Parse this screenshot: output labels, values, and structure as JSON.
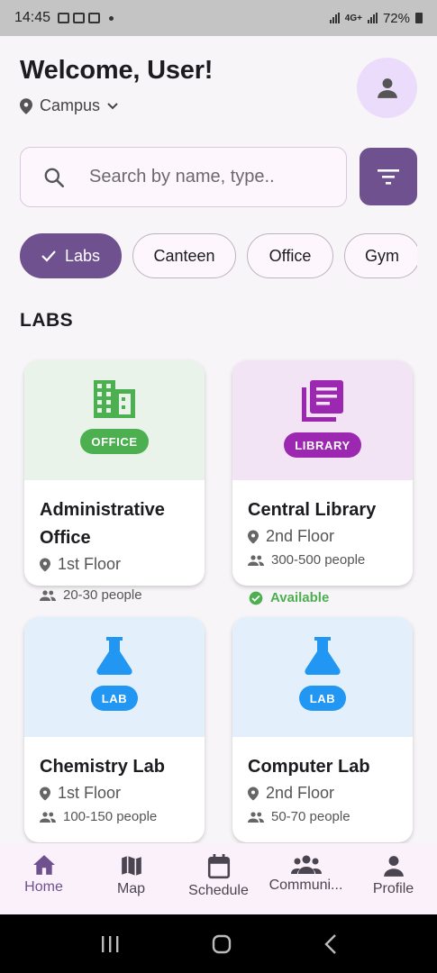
{
  "status_bar": {
    "time": "14:45",
    "network": "4G+",
    "battery": "72%"
  },
  "header": {
    "welcome": "Welcome, User!",
    "location": "Campus"
  },
  "search": {
    "placeholder": "Search by name, type.."
  },
  "chips": [
    {
      "label": "Labs",
      "selected": true
    },
    {
      "label": "Canteen",
      "selected": false
    },
    {
      "label": "Office",
      "selected": false
    },
    {
      "label": "Gym",
      "selected": false
    }
  ],
  "section": {
    "title": "LABS"
  },
  "cards": [
    {
      "badge": "OFFICE",
      "title": "Administrative Office",
      "floor": "1st Floor",
      "capacity": "20-30 people",
      "icon": "building-icon",
      "accent": "#4caf50",
      "bg": "#e9f3ea"
    },
    {
      "badge": "LIBRARY",
      "title": "Central Library",
      "floor": "2nd Floor",
      "capacity": "300-500 people",
      "availability": "Available",
      "icon": "library-books-icon",
      "accent": "#9c27b0",
      "bg": "#f2e4f4"
    },
    {
      "badge": "LAB",
      "title": "Chemistry Lab",
      "floor": "1st Floor",
      "capacity": "100-150 people",
      "icon": "flask-icon",
      "accent": "#2196f3",
      "bg": "#e3f0fc"
    },
    {
      "badge": "LAB",
      "title": "Computer Lab",
      "floor": "2nd Floor",
      "capacity": "50-70 people",
      "icon": "flask-icon",
      "accent": "#2196f3",
      "bg": "#e3f0fc"
    }
  ],
  "bottom_nav": [
    {
      "label": "Home",
      "icon": "home-icon",
      "active": true
    },
    {
      "label": "Map",
      "icon": "map-icon",
      "active": false
    },
    {
      "label": "Schedule",
      "icon": "calendar-icon",
      "active": false
    },
    {
      "label": "Communi...",
      "icon": "community-icon",
      "active": false
    },
    {
      "label": "Profile",
      "icon": "person-icon",
      "active": false
    }
  ],
  "colors": {
    "primary": "#6f5190",
    "avatar_bg": "#ecdcfb",
    "success": "#4caf50"
  }
}
